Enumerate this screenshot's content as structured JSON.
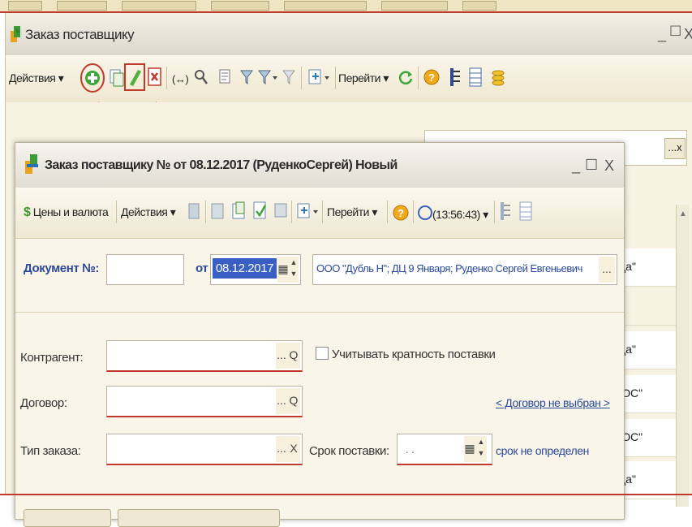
{
  "outer_window": {
    "title": "Заказ поставщику",
    "toolbar": {
      "actions_label": "Действия",
      "goto_label": "Перейти"
    },
    "list_cells": [
      "да\"",
      "да\"",
      "ЮС\"",
      "ЮС\"",
      "да\""
    ],
    "filter_button": "...x"
  },
  "inner_window": {
    "title": "Заказ поставщику № от 08.12.2017 (РуденкоСергей) Новый",
    "toolbar": {
      "prices_label": "Цены и валюта",
      "actions_label": "Действия",
      "goto_label": "Перейти",
      "time_label": "(13:56:43)"
    },
    "form": {
      "doc_number_label": "Документ №:",
      "doc_number_value": "",
      "from_label": "от",
      "date_value": "08.12.2017",
      "org_value": "ООО \"Дубль Н\"; ДЦ 9 Января; Руденко Сергей Евгеньевич",
      "contractor_label": "Контрагент:",
      "contractor_value": "",
      "multiplicity_label": "Учитывать кратность поставки",
      "contract_label": "Договор:",
      "contract_value": "",
      "contract_link": "< Договор не выбран >",
      "order_type_label": "Тип заказа:",
      "order_type_value": "",
      "delivery_term_label": "Срок поставки:",
      "delivery_term_value": ". .",
      "delivery_term_note": "срок не определен"
    }
  },
  "colors": {
    "accent_blue": "#2c4a9c",
    "selection_blue": "#3a5fc4",
    "annotation_red": "#c0392b",
    "window_bg": "#f9f5e8"
  }
}
